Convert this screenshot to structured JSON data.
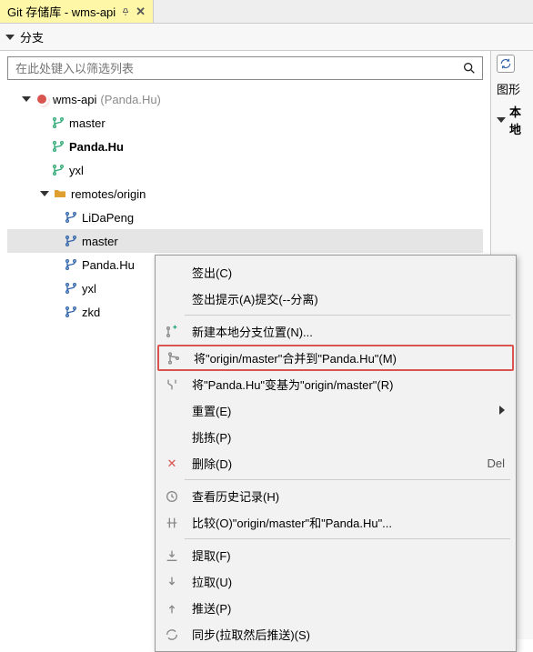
{
  "tab": {
    "title": "Git 存储库 - wms-api"
  },
  "section": {
    "branches": "分支"
  },
  "search": {
    "placeholder": "在此处键入以筛选列表"
  },
  "repo": {
    "name": "wms-api",
    "owner": "(Panda.Hu)"
  },
  "localBranches": [
    "master",
    "Panda.Hu",
    "yxl"
  ],
  "remotesLabel": "remotes/origin",
  "remoteBranches": [
    "LiDaPeng",
    "master",
    "Panda.Hu",
    "yxl",
    "zkd"
  ],
  "right": {
    "graph": "图形",
    "local": "本地"
  },
  "ctx": {
    "checkout": "签出(C)",
    "checkoutDetached": "签出提示(A)提交(--分离)",
    "newLocal": "新建本地分支位置(N)...",
    "merge": "将\"origin/master\"合并到\"Panda.Hu\"(M)",
    "rebase": "将\"Panda.Hu\"变基为\"origin/master\"(R)",
    "reset": "重置(E)",
    "cherrypick": "挑拣(P)",
    "delete": "删除(D)",
    "deleteShortcut": "Del",
    "history": "查看历史记录(H)",
    "compare": "比较(O)\"origin/master\"和\"Panda.Hu\"...",
    "fetch": "提取(F)",
    "pull": "拉取(U)",
    "push": "推送(P)",
    "sync": "同步(拉取然后推送)(S)"
  }
}
